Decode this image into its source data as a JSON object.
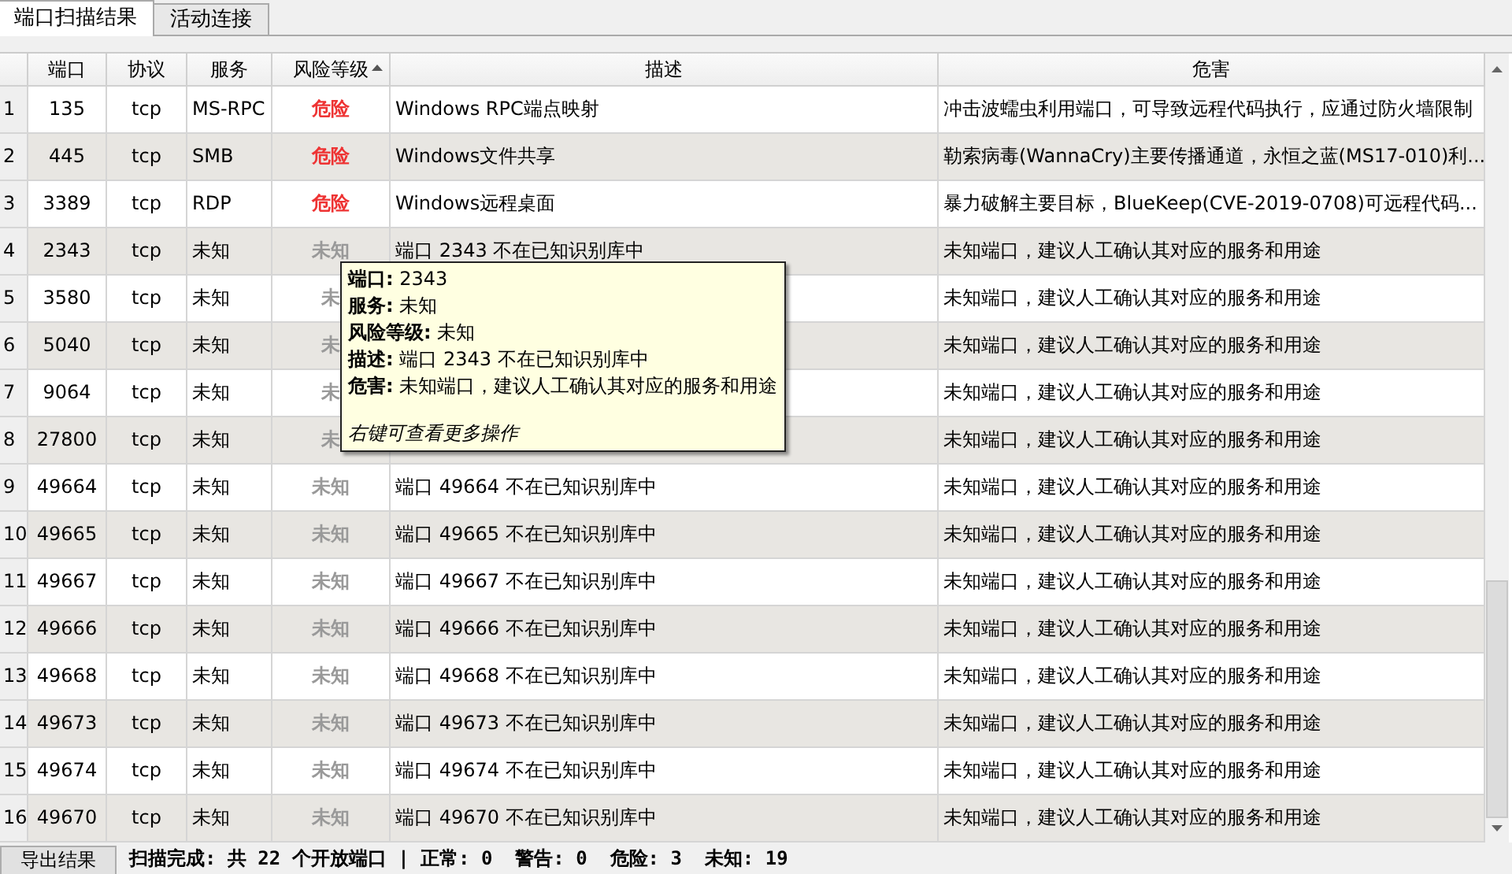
{
  "tabs": [
    {
      "label": "端口扫描结果",
      "selected": true
    },
    {
      "label": "活动连接",
      "selected": false
    }
  ],
  "table": {
    "columns": [
      {
        "label": "端口",
        "sorted": false
      },
      {
        "label": "协议",
        "sorted": false
      },
      {
        "label": "服务",
        "sorted": false
      },
      {
        "label": "风险等级",
        "sorted": true
      },
      {
        "label": "描述",
        "sorted": false
      },
      {
        "label": "危害",
        "sorted": false
      }
    ],
    "rows": [
      {
        "number": "1",
        "port": "135",
        "protocol": "tcp",
        "service": "MS-RPC",
        "risk": "危险",
        "color": "#ee3333",
        "description": "Windows RPC端点映射",
        "harm": "冲击波蠕虫利用端口，可导致远程代码执行，应通过防火墙限制"
      },
      {
        "number": "2",
        "port": "445",
        "protocol": "tcp",
        "service": "SMB",
        "risk": "危险",
        "color": "#ee3333",
        "description": "Windows文件共享",
        "harm": "勒索病毒(WannaCry)主要传播通道，永恒之蓝(MS17-010)利..."
      },
      {
        "number": "3",
        "port": "3389",
        "protocol": "tcp",
        "service": "RDP",
        "risk": "危险",
        "color": "#ee3333",
        "description": "Windows远程桌面",
        "harm": "暴力破解主要目标，BlueKeep(CVE-2019-0708)可远程代码..."
      },
      {
        "number": "4",
        "port": "2343",
        "protocol": "tcp",
        "service": "未知",
        "risk": "未知",
        "color": "#999999",
        "description": "端口 2343 不在已知识别库中",
        "harm": "未知端口，建议人工确认其对应的服务和用途"
      },
      {
        "number": "5",
        "port": "3580",
        "protocol": "tcp",
        "service": "未知",
        "risk": "未",
        "color": "#999999",
        "harm": "未知端口，建议人工确认其对应的服务和用途"
      },
      {
        "number": "6",
        "port": "5040",
        "protocol": "tcp",
        "service": "未知",
        "risk": "未",
        "color": "#999999",
        "harm": "未知端口，建议人工确认其对应的服务和用途"
      },
      {
        "number": "7",
        "port": "9064",
        "protocol": "tcp",
        "service": "未知",
        "risk": "未",
        "color": "#999999",
        "harm": "未知端口，建议人工确认其对应的服务和用途"
      },
      {
        "number": "8",
        "port": "27800",
        "protocol": "tcp",
        "service": "未知",
        "risk": "未",
        "color": "#999999",
        "harm": "未知端口，建议人工确认其对应的服务和用途"
      },
      {
        "number": "9",
        "port": "49664",
        "protocol": "tcp",
        "service": "未知",
        "risk": "未知",
        "color": "#999999",
        "description": "端口 49664 不在已知识别库中",
        "harm": "未知端口，建议人工确认其对应的服务和用途"
      },
      {
        "number": "10",
        "port": "49665",
        "protocol": "tcp",
        "service": "未知",
        "risk": "未知",
        "color": "#999999",
        "description": "端口 49665 不在已知识别库中",
        "harm": "未知端口，建议人工确认其对应的服务和用途"
      },
      {
        "number": "11",
        "port": "49667",
        "protocol": "tcp",
        "service": "未知",
        "risk": "未知",
        "color": "#999999",
        "description": "端口 49667 不在已知识别库中",
        "harm": "未知端口，建议人工确认其对应的服务和用途"
      },
      {
        "number": "12",
        "port": "49666",
        "protocol": "tcp",
        "service": "未知",
        "risk": "未知",
        "color": "#999999",
        "description": "端口 49666 不在已知识别库中",
        "harm": "未知端口，建议人工确认其对应的服务和用途"
      },
      {
        "number": "13",
        "port": "49668",
        "protocol": "tcp",
        "service": "未知",
        "risk": "未知",
        "color": "#999999",
        "description": "端口 49668 不在已知识别库中",
        "harm": "未知端口，建议人工确认其对应的服务和用途"
      },
      {
        "number": "14",
        "port": "49673",
        "protocol": "tcp",
        "service": "未知",
        "risk": "未知",
        "color": "#999999",
        "description": "端口 49673 不在已知识别库中",
        "harm": "未知端口，建议人工确认其对应的服务和用途"
      },
      {
        "number": "15",
        "port": "49674",
        "protocol": "tcp",
        "service": "未知",
        "risk": "未知",
        "color": "#999999",
        "description": "端口 49674 不在已知识别库中",
        "harm": "未知端口，建议人工确认其对应的服务和用途"
      },
      {
        "number": "16",
        "port": "49670",
        "protocol": "tcp",
        "service": "未知",
        "risk": "未知",
        "color": "#999999",
        "description": "端口 49670 不在已知识别库中",
        "harm": "未知端口，建议人工确认其对应的服务和用途"
      }
    ]
  },
  "tooltip": {
    "lines": [
      "**端口:** 2343",
      "**服务:** 未知",
      "**风险等级:** 未知",
      "**描述:** 端口 2343 不在已知识别库中",
      "**危害:** 未知端口，建议人工确认其对应的服务和用途"
    ],
    "hint": "右键可查看更多操作"
  },
  "footer": {
    "export_button": "导出结果",
    "status": "扫描完成: 共 22 个开放端口 | 正常: 0  警告: 0  危险: 3  未知: 19"
  }
}
